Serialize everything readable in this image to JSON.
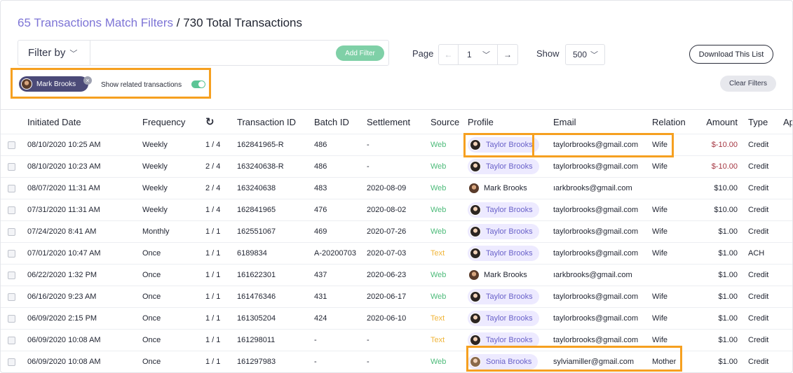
{
  "header": {
    "match_text": "65 Transactions Match Filters",
    "total_text": "/ 730 Total Transactions"
  },
  "filter_bar": {
    "filter_by_label": "Filter by",
    "add_filter_label": "Add Filter"
  },
  "pagination": {
    "page_label": "Page",
    "current_page": "1",
    "show_label": "Show",
    "page_size": "500"
  },
  "download_label": "Download This List",
  "active_filter": {
    "chip_label": "Mark Brooks",
    "remove_glyph": "×",
    "related_label": "Show related transactions",
    "related_enabled": true
  },
  "clear_filters_label": "Clear Filters",
  "table": {
    "columns": {
      "date": "Initiated Date",
      "frequency": "Frequency",
      "iteration": "↻",
      "transaction_id": "Transaction ID",
      "batch_id": "Batch ID",
      "settlement": "Settlement",
      "source": "Source",
      "profile": "Profile",
      "email": "Email",
      "relation": "Relation",
      "amount": "Amount",
      "type": "Type",
      "more": "Ap"
    },
    "rows": [
      {
        "date": "08/10/2020 10:25 AM",
        "frequency": "Weekly",
        "iteration": "1 / 4",
        "transaction_id": "162841965-R",
        "batch_id": "486",
        "settlement": "-",
        "source": "Web",
        "profile": "Taylor Brooks",
        "email": "taylorbrooks@gmail.com",
        "relation": "Wife",
        "amount": "$-10.00",
        "type": "Credit"
      },
      {
        "date": "08/10/2020 10:23 AM",
        "frequency": "Weekly",
        "iteration": "2 / 4",
        "transaction_id": "163240638-R",
        "batch_id": "486",
        "settlement": "-",
        "source": "Web",
        "profile": "Taylor Brooks",
        "email": "taylorbrooks@gmail.com",
        "relation": "Wife",
        "amount": "$-10.00",
        "type": "Credit"
      },
      {
        "date": "08/07/2020 11:31 AM",
        "frequency": "Weekly",
        "iteration": "2 / 4",
        "transaction_id": "163240638",
        "batch_id": "483",
        "settlement": "2020-08-09",
        "source": "Web",
        "profile": "Mark Brooks",
        "email": "ıarkbrooks@gmail.com",
        "relation": "",
        "amount": "$10.00",
        "type": "Credit"
      },
      {
        "date": "07/31/2020 11:31 AM",
        "frequency": "Weekly",
        "iteration": "1 / 4",
        "transaction_id": "162841965",
        "batch_id": "476",
        "settlement": "2020-08-02",
        "source": "Web",
        "profile": "Taylor Brooks",
        "email": "taylorbrooks@gmail.com",
        "relation": "Wife",
        "amount": "$10.00",
        "type": "Credit"
      },
      {
        "date": "07/24/2020 8:41 AM",
        "frequency": "Monthly",
        "iteration": "1 / 1",
        "transaction_id": "162551067",
        "batch_id": "469",
        "settlement": "2020-07-26",
        "source": "Web",
        "profile": "Taylor Brooks",
        "email": "taylorbrooks@gmail.com",
        "relation": "Wife",
        "amount": "$1.00",
        "type": "Credit"
      },
      {
        "date": "07/01/2020 10:47 AM",
        "frequency": "Once",
        "iteration": "1 / 1",
        "transaction_id": "6189834",
        "batch_id": "A-20200703",
        "settlement": "2020-07-03",
        "source": "Text",
        "profile": "Taylor Brooks",
        "email": "taylorbrooks@gmail.com",
        "relation": "Wife",
        "amount": "$1.00",
        "type": "ACH"
      },
      {
        "date": "06/22/2020 1:32 PM",
        "frequency": "Once",
        "iteration": "1 / 1",
        "transaction_id": "161622301",
        "batch_id": "437",
        "settlement": "2020-06-23",
        "source": "Web",
        "profile": "Mark Brooks",
        "email": "ıarkbrooks@gmail.com",
        "relation": "",
        "amount": "$1.00",
        "type": "Credit"
      },
      {
        "date": "06/16/2020 9:23 AM",
        "frequency": "Once",
        "iteration": "1 / 1",
        "transaction_id": "161476346",
        "batch_id": "431",
        "settlement": "2020-06-17",
        "source": "Web",
        "profile": "Taylor Brooks",
        "email": "taylorbrooks@gmail.com",
        "relation": "Wife",
        "amount": "$1.00",
        "type": "Credit"
      },
      {
        "date": "06/09/2020 2:15 PM",
        "frequency": "Once",
        "iteration": "1 / 1",
        "transaction_id": "161305204",
        "batch_id": "424",
        "settlement": "2020-06-10",
        "source": "Text",
        "profile": "Taylor Brooks",
        "email": "taylorbrooks@gmail.com",
        "relation": "Wife",
        "amount": "$1.00",
        "type": "Credit"
      },
      {
        "date": "06/09/2020 10:08 AM",
        "frequency": "Once",
        "iteration": "1 / 1",
        "transaction_id": "161298011",
        "batch_id": "-",
        "settlement": "-",
        "source": "Text",
        "profile": "Taylor Brooks",
        "email": "taylorbrooks@gmail.com",
        "relation": "Wife",
        "amount": "$1.00",
        "type": "Credit"
      },
      {
        "date": "06/09/2020 10:08 AM",
        "frequency": "Once",
        "iteration": "1 / 1",
        "transaction_id": "161297983",
        "batch_id": "-",
        "settlement": "-",
        "source": "Web",
        "profile": "Sonia Brooks",
        "email": "sylviamiller@gmail.com",
        "relation": "Mother",
        "amount": "$1.00",
        "type": "Credit"
      }
    ]
  },
  "colors": {
    "accent": "#7d74d6",
    "highlight": "#f6a020",
    "source_web": "#4dbb7a",
    "source_text": "#f0b53a",
    "negative_amount": "#a53642",
    "add_filter": "#7fd0a7"
  }
}
